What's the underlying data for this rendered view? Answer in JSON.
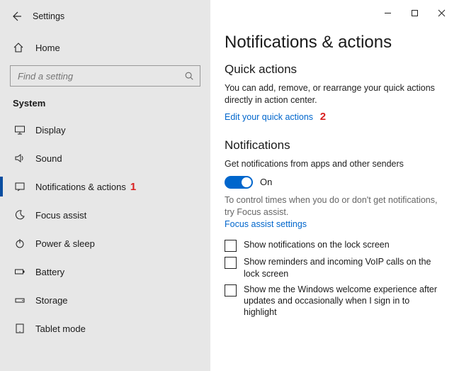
{
  "window": {
    "title": "Settings"
  },
  "home": {
    "label": "Home"
  },
  "search": {
    "placeholder": "Find a setting"
  },
  "section": {
    "header": "System"
  },
  "sidebar": {
    "items": [
      {
        "label": "Display"
      },
      {
        "label": "Sound"
      },
      {
        "label": "Notifications & actions"
      },
      {
        "label": "Focus assist"
      },
      {
        "label": "Power & sleep"
      },
      {
        "label": "Battery"
      },
      {
        "label": "Storage"
      },
      {
        "label": "Tablet mode"
      }
    ]
  },
  "annotations": {
    "one": "1",
    "two": "2"
  },
  "page": {
    "heading": "Notifications & actions",
    "quick": {
      "header": "Quick actions",
      "desc": "You can add, remove, or rearrange your quick actions directly in action center.",
      "link": "Edit your quick actions"
    },
    "notifications": {
      "header": "Notifications",
      "toggle_label": "Get notifications from apps and other senders",
      "toggle_state": "On",
      "hint": "To control times when you do or don't get notifications, try Focus assist.",
      "hint_link": "Focus assist settings",
      "checks": [
        "Show notifications on the lock screen",
        "Show reminders and incoming VoIP calls on the lock screen",
        "Show me the Windows welcome experience after updates and occasionally when I sign in to highlight"
      ]
    }
  }
}
